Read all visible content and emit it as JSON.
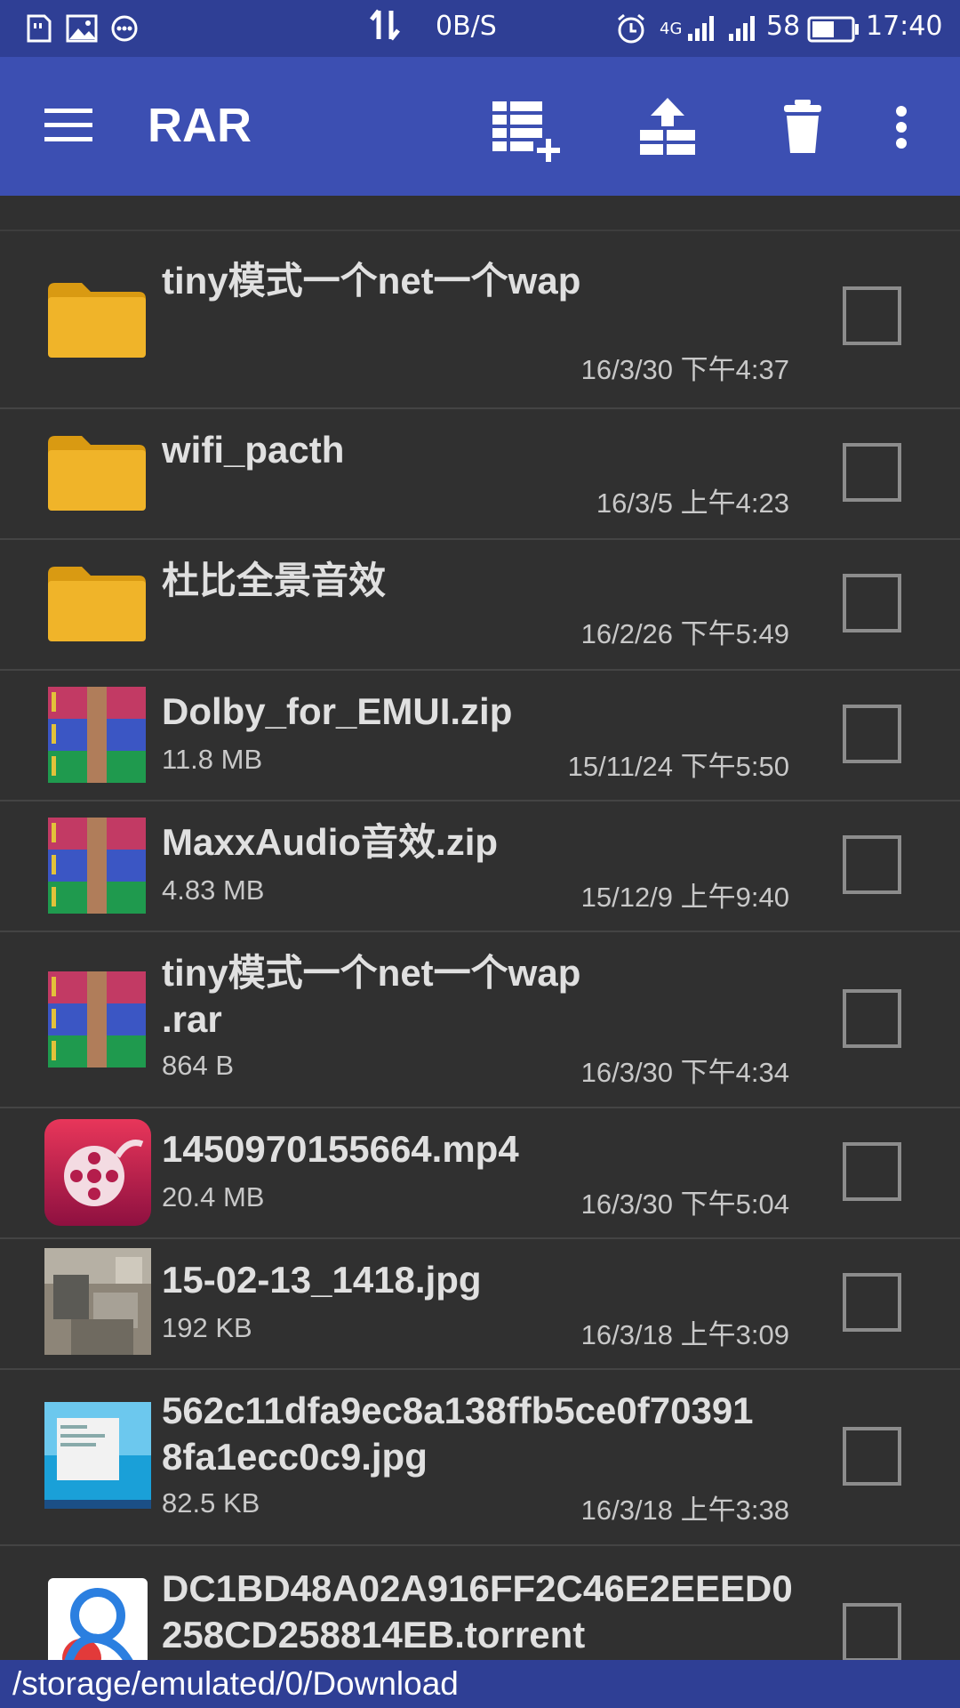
{
  "status_bar": {
    "net_speed": "0B/S",
    "network": "4G",
    "battery": "58",
    "time": "17:40"
  },
  "app_bar": {
    "title": "RAR",
    "actions": [
      "add-to-archive-icon",
      "extract-icon",
      "delete-icon",
      "more-icon"
    ]
  },
  "files": [
    {
      "type": "folder",
      "name_lines": [
        "tiny模式一个net一个wap"
      ],
      "size": "",
      "date": "16/3/30 下午4:37"
    },
    {
      "type": "folder",
      "name_lines": [
        "wifi_pacth"
      ],
      "size": "",
      "date": "16/3/5 上午4:23"
    },
    {
      "type": "folder",
      "name_lines": [
        "杜比全景音效"
      ],
      "size": "",
      "date": "16/2/26 下午5:49"
    },
    {
      "type": "archive",
      "name_lines": [
        "Dolby_for_EMUI.zip"
      ],
      "size": "11.8 MB",
      "date": "15/11/24 下午5:50"
    },
    {
      "type": "archive",
      "name_lines": [
        "MaxxAudio音效.zip"
      ],
      "size": "4.83 MB",
      "date": "15/12/9 上午9:40"
    },
    {
      "type": "archive",
      "name_lines": [
        "tiny模式一个net一个wap",
        ".rar"
      ],
      "size": "864 B",
      "date": "16/3/30 下午4:34"
    },
    {
      "type": "video",
      "name_lines": [
        "1450970155664.mp4"
      ],
      "size": "20.4 MB",
      "date": "16/3/30 下午5:04"
    },
    {
      "type": "photo",
      "name_lines": [
        "15-02-13_1418.jpg"
      ],
      "size": "192 KB",
      "date": "16/3/18 上午3:09"
    },
    {
      "type": "screenshot",
      "name_lines": [
        "562c11dfa9ec8a138ffb5ce0f70391",
        "8fa1ecc0c9.jpg"
      ],
      "size": "82.5 KB",
      "date": "16/3/18 上午3:38"
    },
    {
      "type": "torrent",
      "name_lines": [
        "DC1BD48A02A916FF2C46E2EEED0",
        "258CD258814EB.torrent"
      ],
      "size": "",
      "date": ""
    }
  ],
  "path": "/storage/emulated/0/Download",
  "colors": {
    "status_bar": "#2f3f95",
    "app_bar": "#3c4fb2",
    "background": "#303030",
    "folder": "#f0b429"
  }
}
